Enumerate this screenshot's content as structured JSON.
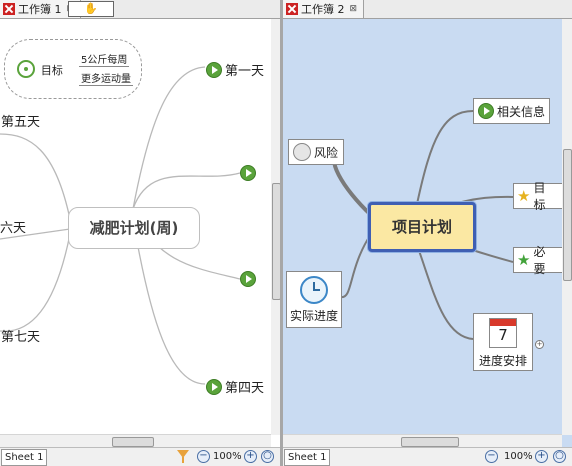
{
  "left": {
    "tab_title": "工作簿 1",
    "tab_close": "⊠",
    "hand_tool": "✋",
    "central": "减肥计划(周)",
    "goal": {
      "label": "目标",
      "items": [
        "5公斤每周",
        "更多运动量"
      ]
    },
    "topics": [
      "第一天",
      "第五天",
      "六天",
      "第七天",
      "第四天"
    ],
    "sheet_tab": "Sheet 1",
    "zoom": "100%",
    "zoom_out": "−",
    "zoom_in": "+",
    "zoom_fit": "○"
  },
  "right": {
    "tab_title": "工作簿 2",
    "tab_close": "⊠",
    "central": "项目计划",
    "topics": {
      "risk": "风险",
      "progress": "实际进度",
      "info": "相关信息",
      "goal": "目标",
      "need": "必要",
      "schedule": "进度安排"
    },
    "calendar_day": "7",
    "expand": "+",
    "sheet_tab": "Sheet 1",
    "zoom": "100%",
    "zoom_out": "−",
    "zoom_in": "+",
    "zoom_fit": "○"
  },
  "icons": {
    "workbook": "xmind-icon",
    "play": "play-icon",
    "target": "target-icon",
    "smiley": "face-icon",
    "clock": "clock-icon",
    "star": "star-icon",
    "calendar": "calendar-icon",
    "filter": "filter-icon"
  },
  "colors": {
    "right_bg": "#c9dbf2",
    "central_fill": "#fbe8a3",
    "central_border": "#3f5fb3",
    "play_green": "#5aa33b"
  }
}
